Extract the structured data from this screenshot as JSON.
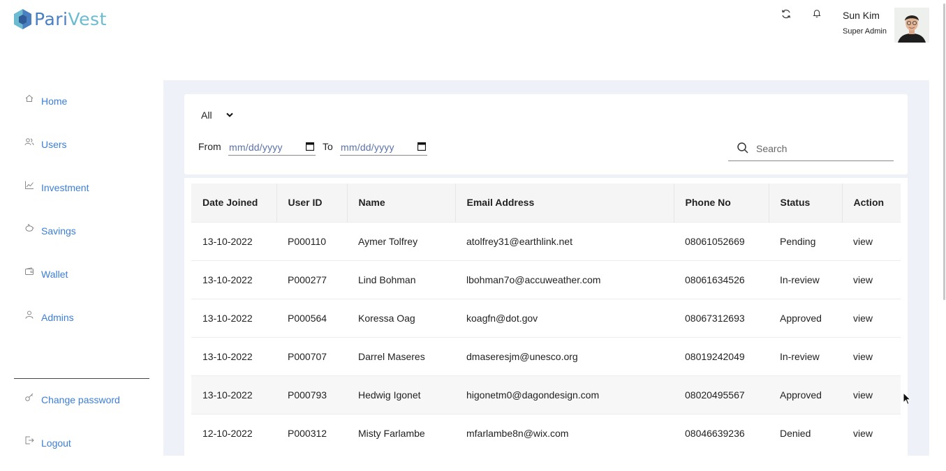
{
  "brand": {
    "part1": "Pari",
    "part2": "Vest",
    "color1": "#4a7fc1",
    "color2": "#6cbbd0"
  },
  "header": {
    "refresh_icon": "refresh-icon",
    "bell_icon": "bell-icon",
    "user_name": "Sun Kim",
    "user_role": "Super Admin"
  },
  "sidebar": {
    "items": [
      {
        "label": "Home",
        "icon": "home-icon"
      },
      {
        "label": "Users",
        "icon": "users-icon"
      },
      {
        "label": "Investment",
        "icon": "chart-icon"
      },
      {
        "label": "Savings",
        "icon": "piggy-bank-icon"
      },
      {
        "label": "Wallet",
        "icon": "wallet-icon"
      },
      {
        "label": "Admins",
        "icon": "user-icon"
      }
    ],
    "bottom": [
      {
        "label": "Change password",
        "icon": "key-icon"
      },
      {
        "label": "Logout",
        "icon": "logout-icon"
      }
    ]
  },
  "filters": {
    "status_selected": "All",
    "from_label": "From",
    "to_label": "To",
    "date_placeholder": "mm/dd/yyyy",
    "search_placeholder": "Search"
  },
  "table": {
    "headers": [
      "Date Joined",
      "User ID",
      "Name",
      "Email Address",
      "Phone No",
      "Status",
      "Action"
    ],
    "rows": [
      [
        "13-10-2022",
        "P000110",
        "Aymer Tolfrey",
        "atolfrey31@earthlink.net",
        "08061052669",
        "Pending",
        "view"
      ],
      [
        "13-10-2022",
        "P000277",
        "Lind Bohman",
        "lbohman7o@accuweather.com",
        "08061634526",
        "In-review",
        "view"
      ],
      [
        "13-10-2022",
        "P000564",
        "Koressa Oag",
        "koagfn@dot.gov",
        "08067312693",
        "Approved",
        "view"
      ],
      [
        "13-10-2022",
        "P000707",
        "Darrel Maseres",
        "dmaseresjm@unesco.org",
        "08019242049",
        "In-review",
        "view"
      ],
      [
        "13-10-2022",
        "P000793",
        "Hedwig Igonet",
        "higonetm0@dagondesign.com",
        "08020495567",
        "Approved",
        "view"
      ],
      [
        "12-10-2022",
        "P000312",
        "Misty Farlambe",
        "mfarlambe8n@wix.com",
        "08046639236",
        "Denied",
        "view"
      ]
    ]
  },
  "colors": {
    "accent": "#3c7ed6",
    "main_bg": "#eef1f8"
  }
}
